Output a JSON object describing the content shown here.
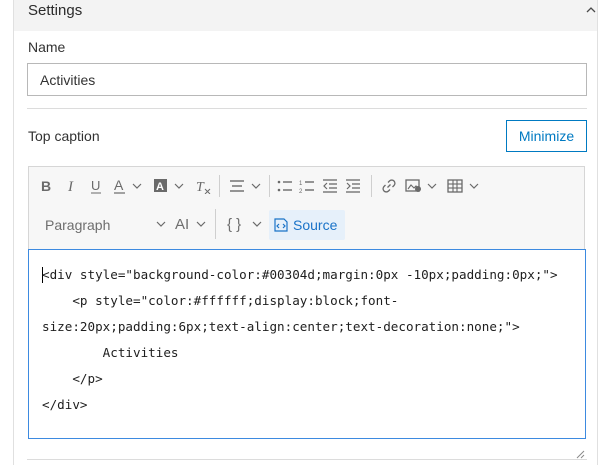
{
  "settings": {
    "title": "Settings",
    "collapse_icon": "chevron-up-icon"
  },
  "name_field": {
    "label": "Name",
    "value": "Activities"
  },
  "top_caption": {
    "label": "Top caption",
    "minimize_label": "Minimize"
  },
  "toolbar": {
    "items": [
      "bold-icon",
      "italic-icon",
      "underline-icon",
      "font-color-icon",
      "highlight-color-icon",
      "clear-format-icon",
      "align-icon",
      "bulleted-list-icon",
      "numbered-list-icon",
      "decrease-indent-icon",
      "increase-indent-icon",
      "link-icon",
      "insert-image-icon",
      "table-icon",
      "code-block-icon",
      "source-icon"
    ],
    "paragraph_label": "Paragraph",
    "ai_label": "AI",
    "braces_label": "{ }",
    "source_label": "Source"
  },
  "editor": {
    "lines": [
      "<div style=\"background-color:#00304d;margin:0px -10px;padding:0px;\">",
      "    <p style=\"color:#ffffff;display:block;font-",
      "size:20px;padding:6px;text-align:center;text-decoration:none;\">",
      "        Activities",
      "    </p>",
      "</div>"
    ]
  },
  "colors": {
    "accent": "#007ac2",
    "source_text": "#1a73c8",
    "editor_focus_border": "#3d8ae0"
  }
}
